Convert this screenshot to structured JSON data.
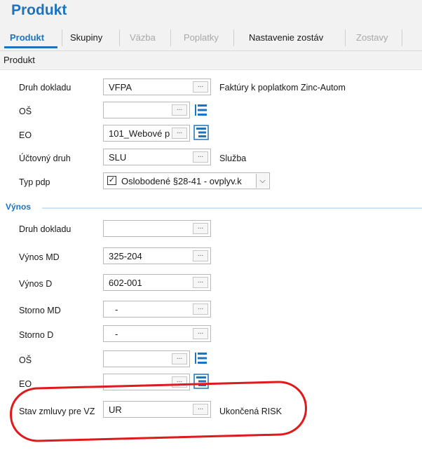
{
  "app": {
    "title": "Produkt"
  },
  "tabs": [
    {
      "label": "Produkt",
      "state": "active"
    },
    {
      "label": "Skupiny",
      "state": "normal"
    },
    {
      "label": "Väzba",
      "state": "disabled"
    },
    {
      "label": "Poplatky",
      "state": "disabled"
    },
    {
      "label": "Nastavenie zostáv",
      "state": "normal"
    },
    {
      "label": "Zostavy",
      "state": "disabled"
    }
  ],
  "section": {
    "title": "Produkt"
  },
  "produkt": {
    "druh_dokladu": {
      "label": "Druh dokladu",
      "value": "VFPA",
      "desc": "Faktúry k poplatkom Zinc-Autom"
    },
    "os": {
      "label": "OŠ",
      "value": ""
    },
    "eo": {
      "label": "EO",
      "value": "101_Webové p"
    },
    "uctovny_druh": {
      "label": "Účtovný druh",
      "value": "SLU",
      "desc": "Služba"
    },
    "typ_pdp": {
      "label": "Typ pdp",
      "value": "Oslobodené §28-41 - ovplyv.k",
      "checked": true
    }
  },
  "vynos": {
    "group_title": "Výnos",
    "druh_dokladu": {
      "label": "Druh dokladu",
      "value": ""
    },
    "vynos_md": {
      "label": "Výnos MD",
      "value": "325-204"
    },
    "vynos_d": {
      "label": "Výnos D",
      "value": "602-001"
    },
    "storno_md": {
      "label": "Storno MD",
      "value": "-"
    },
    "storno_d": {
      "label": "Storno D",
      "value": "-"
    },
    "os": {
      "label": "OŠ",
      "value": ""
    },
    "eo": {
      "label": "EO",
      "value": ""
    },
    "stav_zmluvy": {
      "label": "Stav zmluvy pre VZ",
      "value": "UR",
      "desc": "Ukončená RISK"
    }
  },
  "glyphs": {
    "dots": "...",
    "check": "✓",
    "dropdown": "⌵"
  },
  "colors": {
    "accent": "#1e73be",
    "annotation": "#e0191b"
  }
}
